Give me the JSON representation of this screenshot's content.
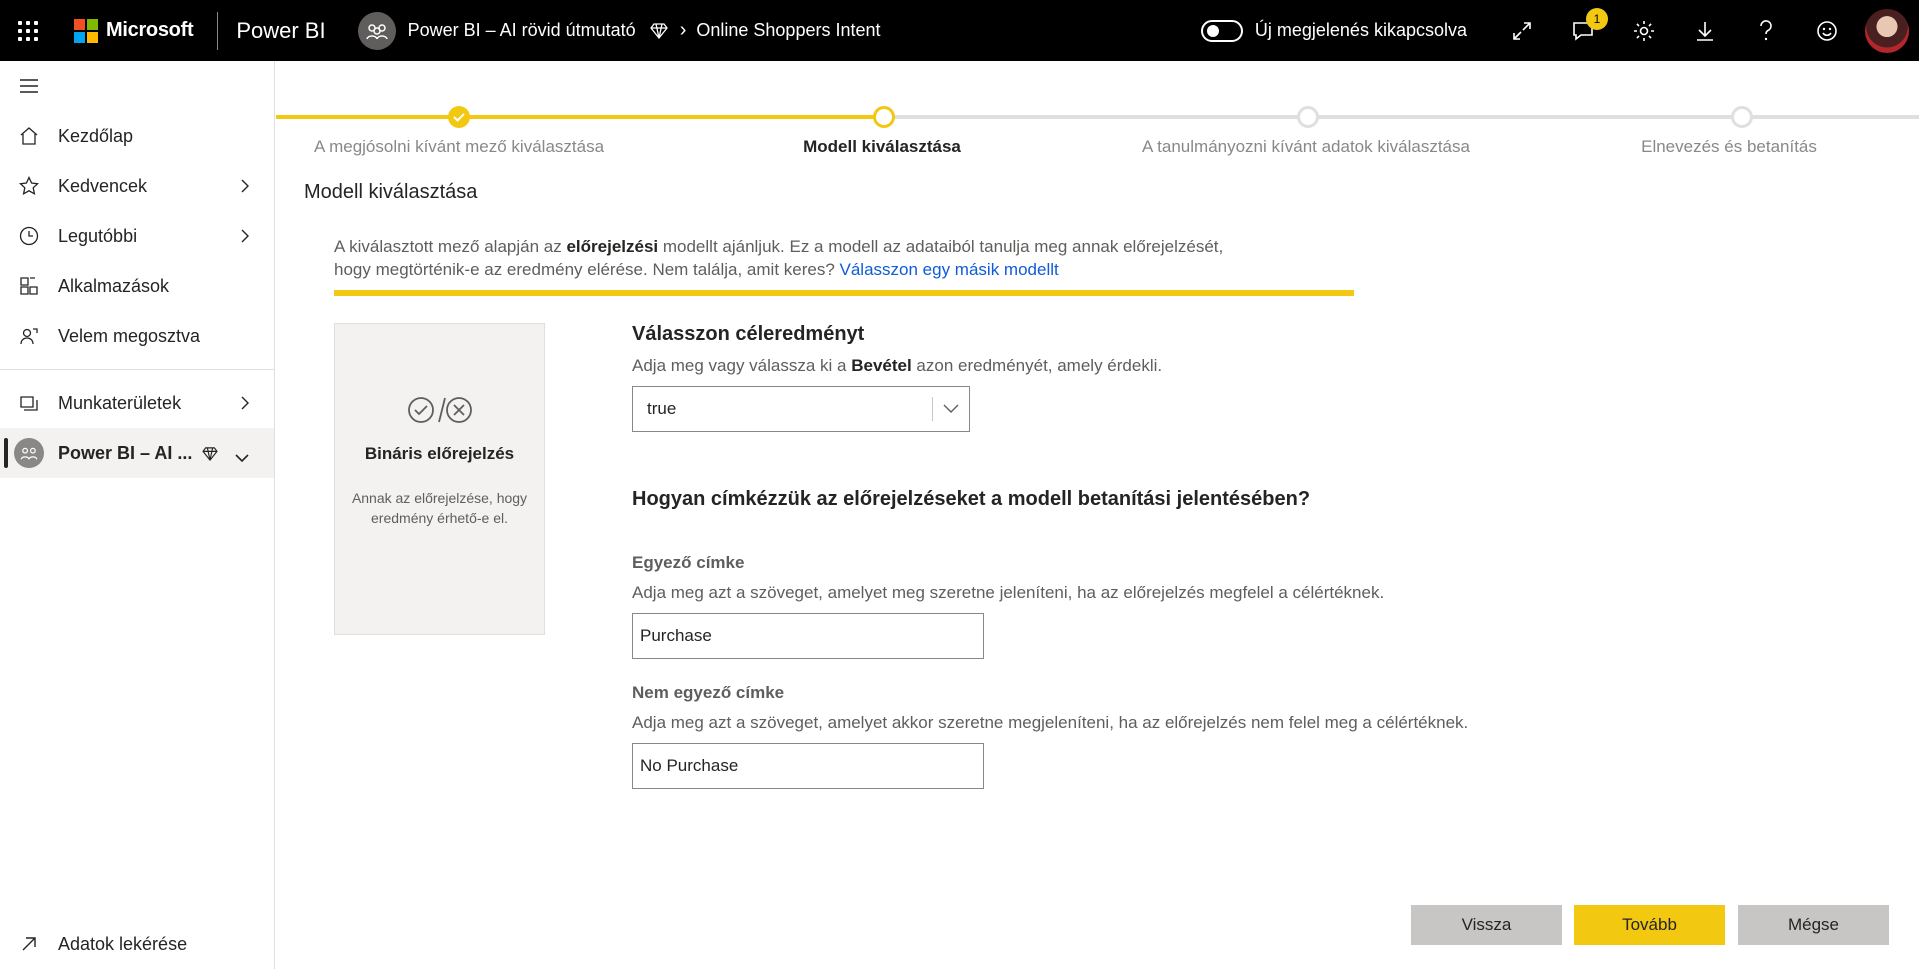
{
  "colors": {
    "accent": "#f2c811",
    "link": "#0f5bd9",
    "topbar": "#000000",
    "inactive": "#e1dfdd"
  },
  "topbar": {
    "brand": "Microsoft",
    "product": "Power BI",
    "workspace": "Power BI – AI rövid útmutató",
    "dataset": "Online Shoppers Intent",
    "toggle_label": "Új megjelenés kikapcsolva",
    "notification_count": "1"
  },
  "sidebar": {
    "items": [
      {
        "label": "Kezdőlap",
        "icon": "home-icon"
      },
      {
        "label": "Kedvencek",
        "icon": "star-icon"
      },
      {
        "label": "Legutóbbi",
        "icon": "clock-icon"
      },
      {
        "label": "Alkalmazások",
        "icon": "apps-icon"
      },
      {
        "label": "Velem megosztva",
        "icon": "shared-icon"
      }
    ],
    "workspaces": "Munkaterületek",
    "current_workspace": "Power BI – AI ...",
    "get_data": "Adatok lekérése"
  },
  "stepper": {
    "steps": [
      {
        "label": "A megjósolni kívánt mező kiválasztása",
        "state": "done"
      },
      {
        "label": "Modell kiválasztása",
        "state": "current"
      },
      {
        "label": "A tanulmányozni kívánt adatok kiválasztása",
        "state": "todo"
      },
      {
        "label": "Elnevezés és betanítás",
        "state": "todo"
      }
    ]
  },
  "main": {
    "section_title": "Modell kiválasztása",
    "info_prefix": "A kiválasztott mező alapján az ",
    "info_bold": "előrejelzési",
    "info_middle": " modellt ajánljuk. Ez a modell az adataiból tanulja meg annak előrejelzését,",
    "info_line2": "hogy megtörténik-e az eredmény elérése. Nem találja, amit keres? ",
    "info_link": "Válasszon egy másik modellt",
    "card_title": "Bináris előrejelzés",
    "card_desc": "Annak az előrejelzése, hogy eredmény érhető-e el.",
    "target_heading": "Válasszon céleredményt",
    "target_hint_prefix": "Adja meg vagy válassza ki a ",
    "target_hint_bold": "Bevétel",
    "target_hint_suffix": " azon eredményét, amely érdekli.",
    "target_value": "true",
    "labels_heading": "Hogyan címkézzük az előrejelzéseket a modell betanítási jelentésében?",
    "match_label": "Egyező címke",
    "match_hint": "Adja meg azt a szöveget, amelyet meg szeretne jeleníteni, ha az előrejelzés megfelel a célértéknek.",
    "match_value": "Purchase",
    "nomatch_label": "Nem egyező címke",
    "nomatch_hint": "Adja meg azt a szöveget, amelyet akkor szeretne megjeleníteni, ha az előrejelzés nem felel meg a célértéknek.",
    "nomatch_value": "No Purchase"
  },
  "buttons": {
    "back": "Vissza",
    "next": "Tovább",
    "cancel": "Mégse"
  }
}
